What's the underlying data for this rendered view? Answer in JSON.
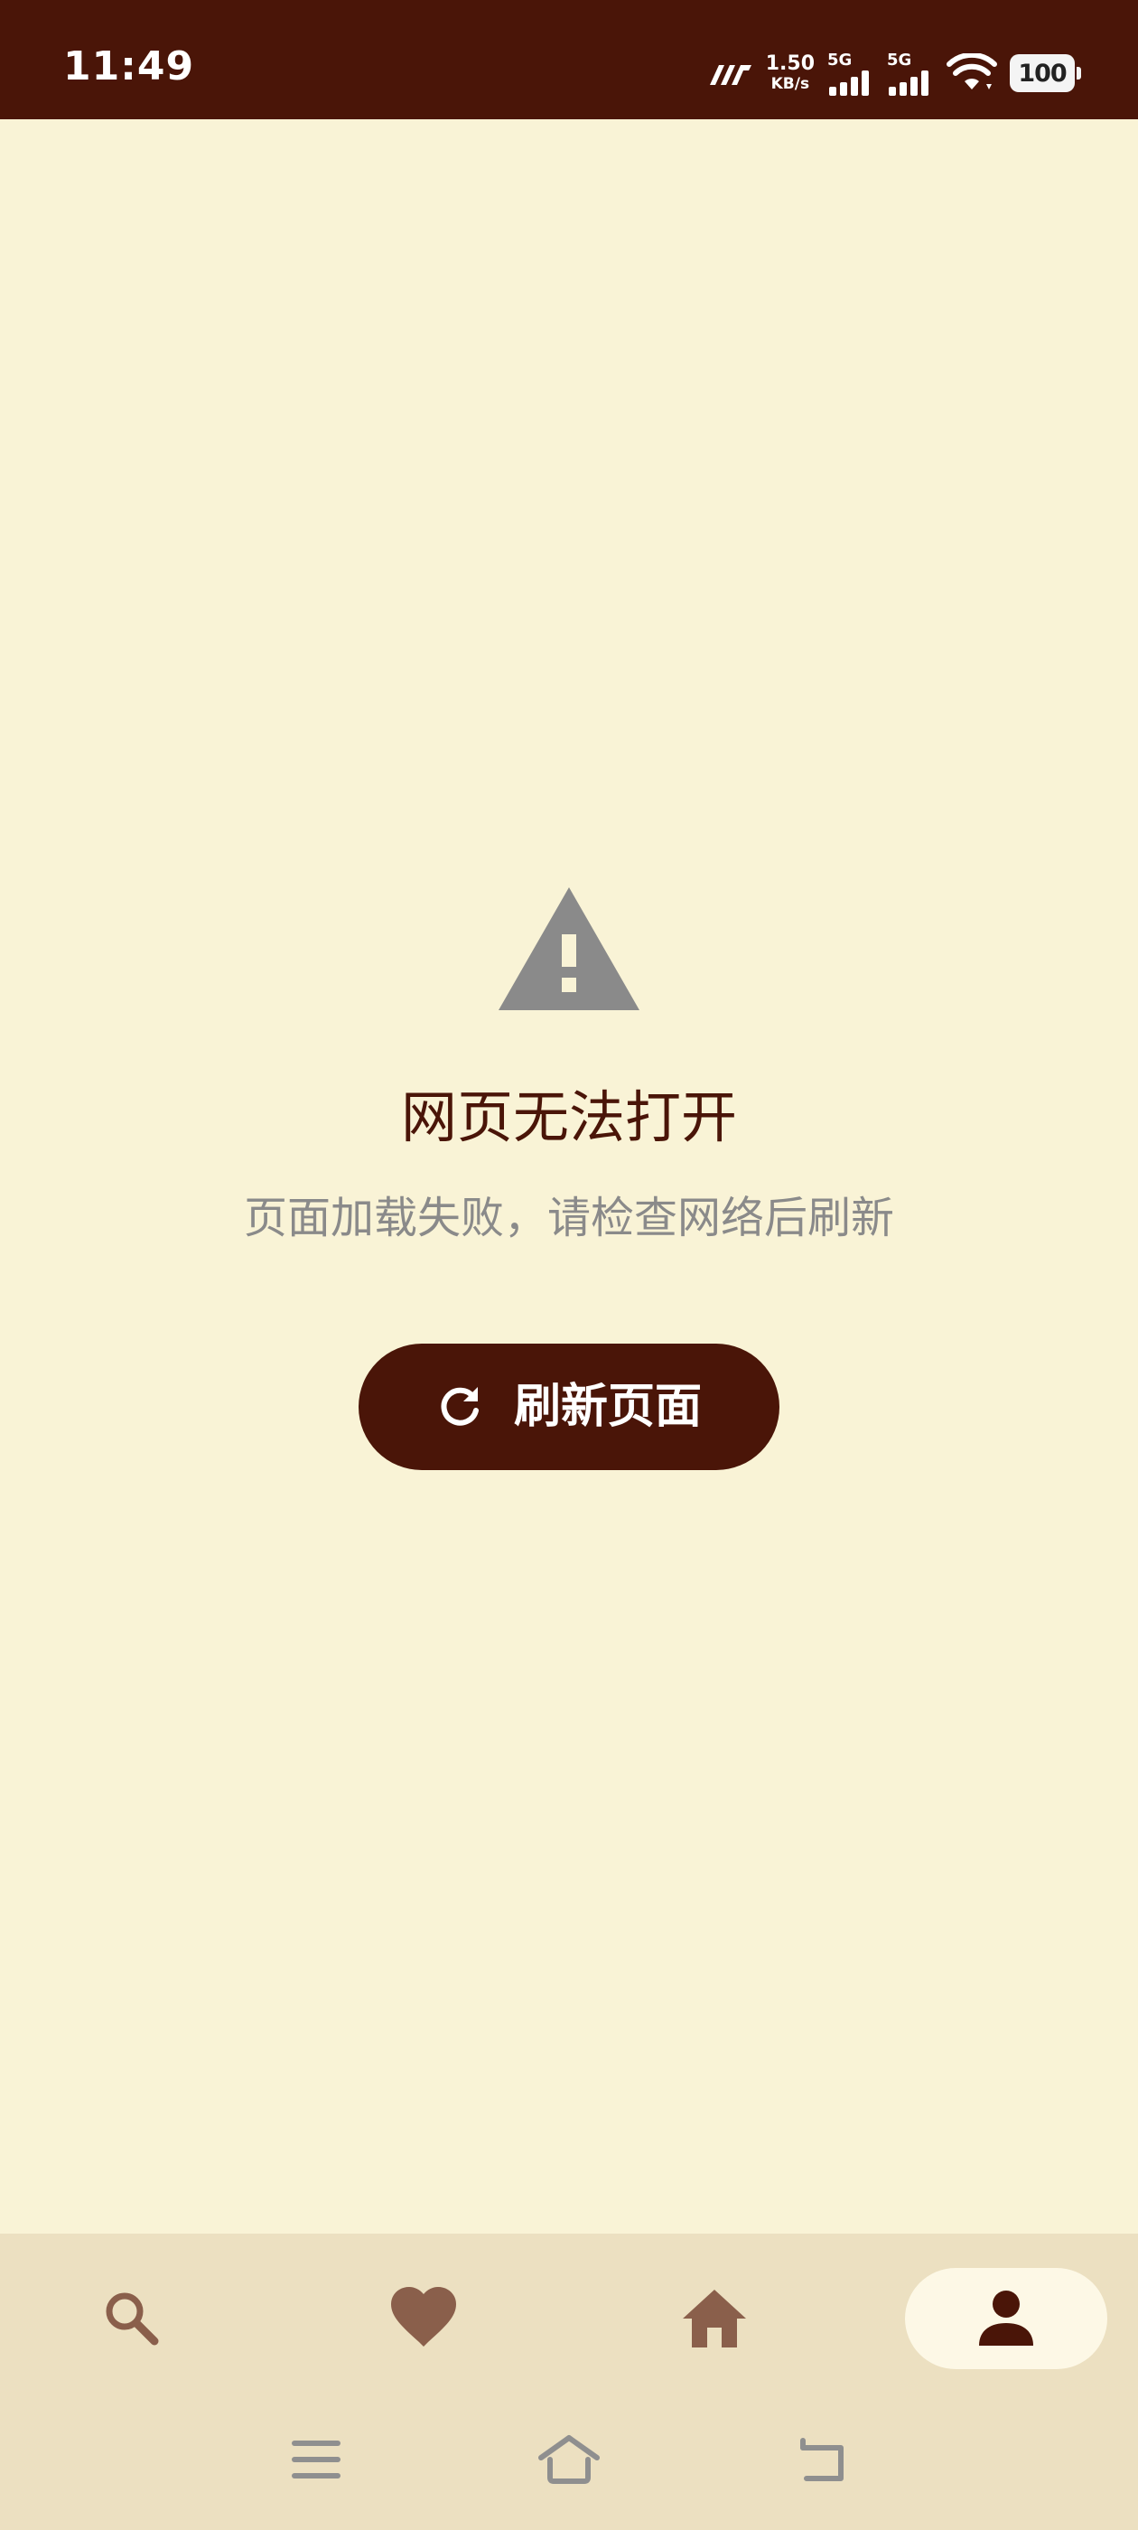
{
  "status_bar": {
    "time": "11:49",
    "net_speed_value": "1.50",
    "net_speed_unit": "KB/s",
    "sim1_network": "5G",
    "sim2_network": "5G",
    "battery_level": "100",
    "icons": [
      "carrier-logo-icon",
      "signal-icon",
      "signal-icon",
      "wifi-icon",
      "battery-icon"
    ]
  },
  "error": {
    "icon": "warning-icon",
    "title": "网页无法打开",
    "message": "页面加载失败，请检查网络后刷新",
    "refresh_button_label": "刷新页面",
    "refresh_icon": "refresh-icon"
  },
  "bottom_nav": {
    "items": [
      {
        "icon": "search-icon",
        "active": false
      },
      {
        "icon": "heart-icon",
        "active": false
      },
      {
        "icon": "home-icon",
        "active": false
      },
      {
        "icon": "person-icon",
        "active": true
      }
    ]
  },
  "system_nav": {
    "buttons": [
      "menu-icon",
      "home-outline-icon",
      "back-icon"
    ]
  },
  "colors": {
    "primary": "#4a1508",
    "background": "#f9f3d6",
    "nav_background": "#ece0c1",
    "nav_icon": "#8a5f4b",
    "active_pill": "#fdf8e6",
    "muted_text": "#8a8a8a",
    "warning_icon": "#8a8a8a"
  }
}
